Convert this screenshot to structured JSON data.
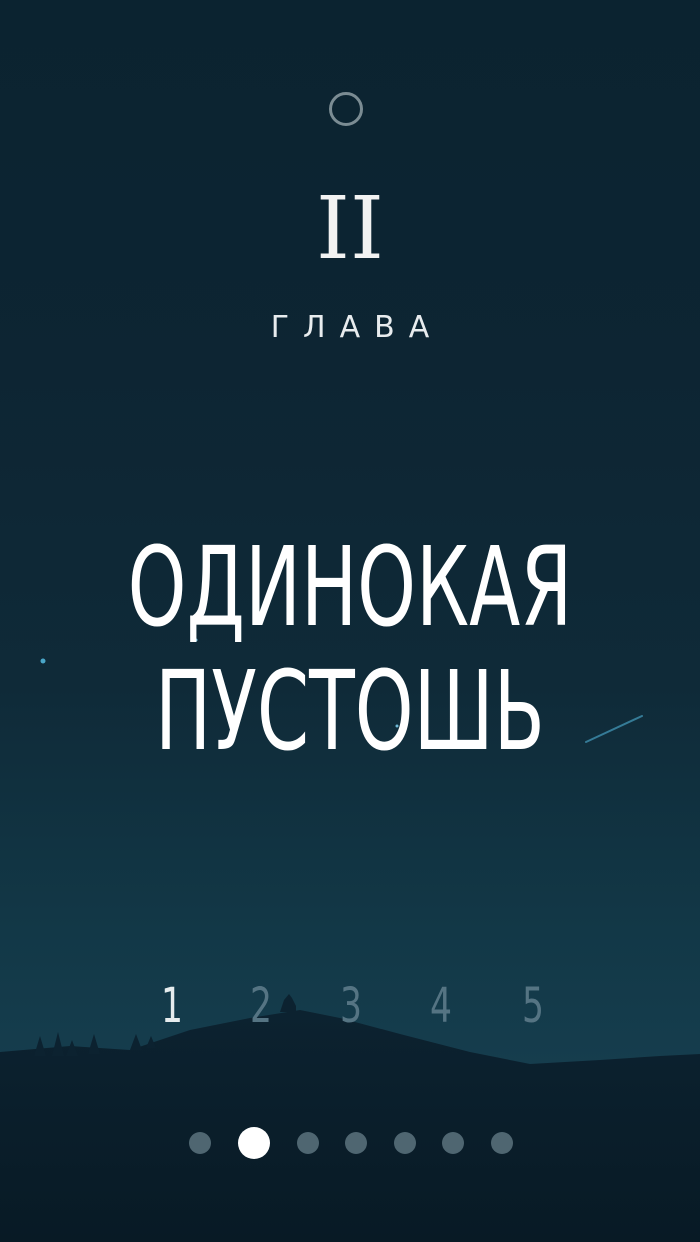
{
  "chapter": {
    "numeral": "II",
    "label": "ГЛАВА",
    "title_line1": "ОДИНОКАЯ",
    "title_line2": "ПУСТОШЬ"
  },
  "levels": [
    {
      "label": "1",
      "active": true
    },
    {
      "label": "2",
      "active": false
    },
    {
      "label": "3",
      "active": false
    },
    {
      "label": "4",
      "active": false
    },
    {
      "label": "5",
      "active": false
    }
  ],
  "pagination": {
    "total": 7,
    "current_index": 1
  },
  "colors": {
    "background_top": "#0b2330",
    "background_bottom": "#173f50",
    "text": "#ffffff",
    "inactive_level": "#557483",
    "inactive_dot": "#4f6671"
  }
}
